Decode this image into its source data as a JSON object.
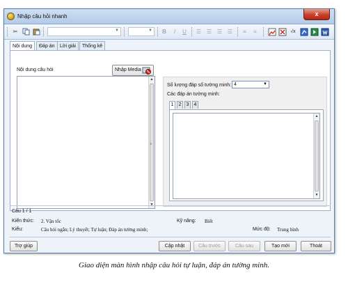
{
  "window": {
    "title": "Nhập câu hỏi nhanh",
    "close_label": "x"
  },
  "toolbar": {
    "icons": [
      "cut-icon",
      "copy-icon",
      "paste-icon",
      "bold-icon",
      "italic-icon",
      "underline-icon",
      "align-left-icon",
      "align-center-icon",
      "align-right-icon",
      "justify-icon",
      "numbered-list-icon",
      "bullet-list-icon",
      "image-icon",
      "table-icon",
      "formula-icon",
      "chart-icon",
      "flash-icon",
      "word-icon"
    ],
    "bold_label": "B",
    "italic_label": "I",
    "underline_label": "U",
    "formula_label": "√x"
  },
  "tabs": [
    {
      "label": "Nội dung",
      "active": true
    },
    {
      "label": "Đáp án",
      "active": false
    },
    {
      "label": "Lời giải",
      "active": false
    },
    {
      "label": "Thống kê",
      "active": false
    }
  ],
  "content": {
    "question_label": "Nội dung câu hỏi",
    "import_media_label": "Nhập Media",
    "answer_count_label": "Số lượng đáp số tường minh:",
    "answer_count_value": "4",
    "explicit_answers_label": "Các đáp án tường minh:",
    "answer_tabs": [
      "1",
      "2",
      "3",
      "4"
    ]
  },
  "status": {
    "question_index": "Câu 1 / 1",
    "knowledge_label": "Kiến thức:",
    "knowledge_value": "2. Vận tốc",
    "skill_label": "Kỹ năng:",
    "skill_value": "Biết",
    "type_label": "Kiểu:",
    "type_value": "Câu hỏi ngắn; Lý thuyết; Tự luận; Đáp án tường minh;",
    "level_label": "Mức độ:",
    "level_value": "Trung bình"
  },
  "buttons": {
    "help": "Trợ giúp",
    "update": "Cập nhật",
    "previous": "Câu trước",
    "next": "Câu sau",
    "new": "Tạo mới",
    "exit": "Thoát"
  },
  "caption": "Giao diện màn hình nhập câu hỏi tự luận, đáp án tường minh."
}
